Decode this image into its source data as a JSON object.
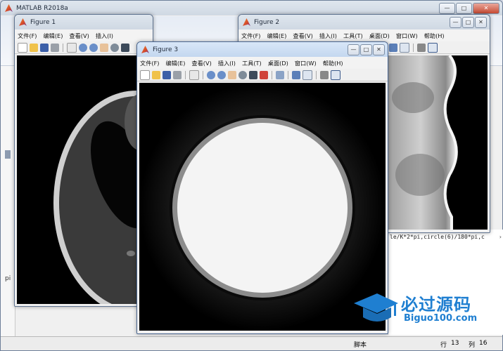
{
  "main_window": {
    "title": "MATLAB R2018a",
    "min": "—",
    "max": "□",
    "close": "✕",
    "command_snippet": "le/K*2*pi,circle(6)/180*pi,c",
    "side_label": "pi",
    "status": {
      "script": "脚本",
      "row_label": "行",
      "row": "13",
      "col_label": "列",
      "col": "16"
    }
  },
  "menus": [
    "文件(F)",
    "编辑(E)",
    "查看(V)",
    "插入(I)",
    "工具(T)",
    "桌面(D)",
    "窗口(W)",
    "帮助(H)"
  ],
  "figures": {
    "fig1": {
      "title": "Figure 1"
    },
    "fig2": {
      "title": "Figure 2"
    },
    "fig3": {
      "title": "Figure 3"
    }
  },
  "watermark": {
    "brand": "必过源码",
    "site": "Biguo100.com"
  },
  "colors": {
    "titlebar": "#c4d7ef",
    "plot_bg": "#000000",
    "disc": "#f4f4f4",
    "ring": "#8c8c8c"
  }
}
